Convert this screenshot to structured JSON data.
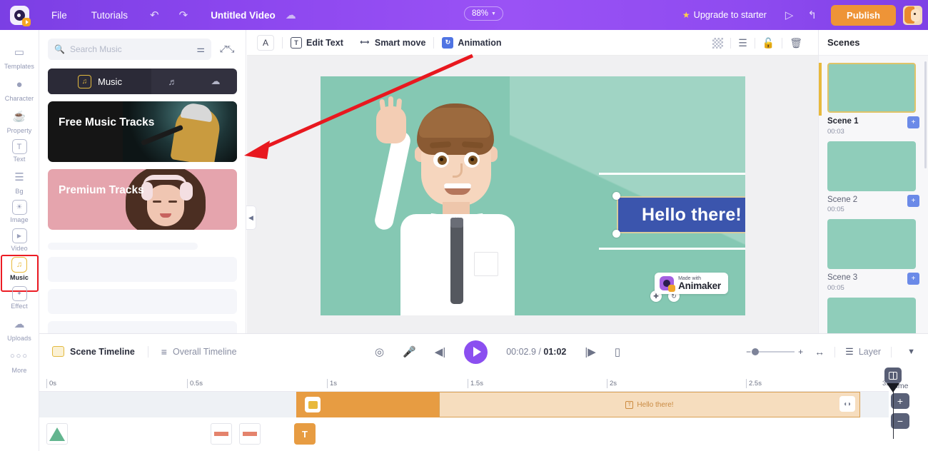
{
  "topbar": {
    "menu": [
      {
        "label": "File",
        "name": "menu-file"
      },
      {
        "label": "Tutorials",
        "name": "menu-tutorials"
      }
    ],
    "undo_icon": "undo-icon",
    "redo_icon": "redo-icon",
    "project_title": "Untitled Video",
    "cloud_icon": "cloud-saved-icon",
    "zoom_level": "88%",
    "upgrade_label": "Upgrade to starter",
    "preview_icon": "preview-play-icon",
    "share_icon": "share-icon",
    "publish_label": "Publish",
    "avatar_name": "user-avatar"
  },
  "rail": {
    "items": [
      {
        "label": "Templates",
        "icon": "templates-icon",
        "active": false
      },
      {
        "label": "Character",
        "icon": "character-icon",
        "active": false
      },
      {
        "label": "Property",
        "icon": "property-cup-icon",
        "active": false
      },
      {
        "label": "Text",
        "icon": "text-t-icon",
        "active": false
      },
      {
        "label": "Bg",
        "icon": "background-layers-icon",
        "active": false
      },
      {
        "label": "Image",
        "icon": "image-icon",
        "active": false
      },
      {
        "label": "Video",
        "icon": "video-play-icon",
        "active": false
      },
      {
        "label": "Music",
        "icon": "music-note-icon",
        "active": true
      },
      {
        "label": "Effect",
        "icon": "effect-sparkle-icon",
        "active": false
      },
      {
        "label": "Uploads",
        "icon": "upload-cloud-icon",
        "active": false
      },
      {
        "label": "More",
        "icon": "more-dots-icon",
        "active": false
      }
    ]
  },
  "music_panel": {
    "search_placeholder": "Search Music",
    "search_value": "",
    "search_icon": "search-icon",
    "filter_icon": "filter-sliders-icon",
    "expand_icon": "expand-fullscreen-icon",
    "tabs": [
      {
        "label": "Music",
        "name": "tab-music",
        "icon": "music-box-icon",
        "active": true
      },
      {
        "label": "",
        "name": "tab-sound-effects",
        "icon": "sound-effects-icon",
        "active": false
      },
      {
        "label": "",
        "name": "tab-upload-music",
        "icon": "upload-cloud-icon",
        "active": false
      }
    ],
    "cards": [
      {
        "title": "Free Music Tracks",
        "name": "free-music-tracks-card"
      },
      {
        "title": "Premium Tracks",
        "name": "premium-tracks-card"
      }
    ],
    "collapse_icon": "chevron-left-icon"
  },
  "canvas_toolbar": {
    "font_button": "A",
    "edit_text_label": "Edit Text",
    "edit_text_icon": "edit-text-icon",
    "smart_move_label": "Smart move",
    "smart_move_icon": "smart-move-icon",
    "animation_label": "Animation",
    "animation_icon": "animation-icon",
    "right_icons": [
      {
        "name": "transparency-icon"
      },
      {
        "name": "arrange-layers-icon"
      },
      {
        "name": "unlock-icon"
      },
      {
        "name": "delete-trash-icon"
      }
    ]
  },
  "canvas": {
    "text_element": "Hello there!",
    "move_icon": "move-handle-icon",
    "rotate_icon": "rotate-handle-icon",
    "watermark_top": "Made with",
    "watermark_bottom": "Animaker",
    "background_color": "#85c8b3",
    "text_highlight_color": "#3b55ad"
  },
  "scenes": {
    "title": "Scenes",
    "items": [
      {
        "name": "Scene 1",
        "duration": "00:03",
        "selected": true
      },
      {
        "name": "Scene 2",
        "duration": "00:05",
        "selected": false
      },
      {
        "name": "Scene 3",
        "duration": "00:05",
        "selected": false
      }
    ],
    "add_icon": "add-scene-icon"
  },
  "timeline_bar": {
    "scene_timeline_label": "Scene Timeline",
    "scene_timeline_icon": "scene-timeline-icon",
    "overall_timeline_label": "Overall Timeline",
    "overall_timeline_icon": "overall-timeline-icon",
    "focus_icon": "focus-target-icon",
    "mic_icon": "microphone-icon",
    "prev_icon": "skip-previous-icon",
    "play_icon": "play-icon",
    "current_time": "00:02.9",
    "total_time": "01:02",
    "time_separator": "/",
    "next_icon": "skip-next-icon",
    "subtitle_icon": "subtitle-icon",
    "zoom_out_icon": "zoom-out-icon",
    "zoom_in_icon": "zoom-in-icon",
    "fit_icon": "fit-width-icon",
    "layer_label": "Layer",
    "layer_icon": "layer-stack-icon",
    "collapse_icon": "chevron-down-icon"
  },
  "timeline": {
    "ruler_ticks": [
      "0s",
      "0.5s",
      "1s",
      "1.5s",
      "2s",
      "2.5s",
      "3s"
    ],
    "clip_label": "Hello there!",
    "clip_icon": "text-clip-icon",
    "clip_start_icon": "scene-clip-icon",
    "clip_end_icon": "clip-transition-icon",
    "item_icons": [
      {
        "name": "shape-triangle-item"
      },
      {
        "name": "line-item-1"
      },
      {
        "name": "line-item-2"
      },
      {
        "name": "text-item"
      }
    ],
    "playhead_icon": "playhead-grip-icon",
    "time_label": "Time",
    "time_plus": "+",
    "time_minus": "−"
  }
}
